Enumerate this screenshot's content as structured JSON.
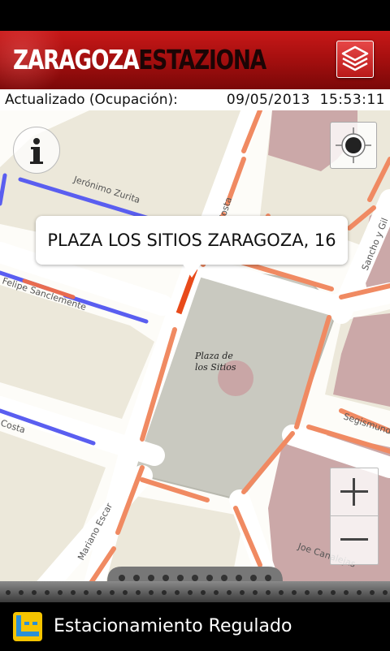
{
  "header": {
    "logo_part1": "ZARAGOZA",
    "logo_part2": "ESTAZIONA",
    "layers_icon": "layers-icon",
    "accent_color": "#b01010"
  },
  "info_bar": {
    "label": "Actualizado (Ocupación):",
    "date": "09/05/2013",
    "time": "15:53:11"
  },
  "map": {
    "callout_text": "PLAZA LOS SITIOS ZARAGOZA, 16",
    "place_label_line1": "Plaza de",
    "place_label_line2": "los Sitios",
    "streets": [
      "Jerónimo Zurita",
      "Felipe Sanclemente",
      "Costa",
      "Mariano Escar",
      "Joaquín Costa",
      "Sancho y Gil",
      "Segismundo",
      "Joe Canalejas"
    ],
    "zoom_in_label": "+",
    "zoom_out_label": "−",
    "info_icon": "info-icon",
    "locate_icon": "locate-icon",
    "colors": {
      "occupancy_high": "#f07a50",
      "occupancy_free": "#5a5ef0",
      "selected": "#e84a1a"
    }
  },
  "footer": {
    "title": "Estacionamiento Regulado"
  }
}
